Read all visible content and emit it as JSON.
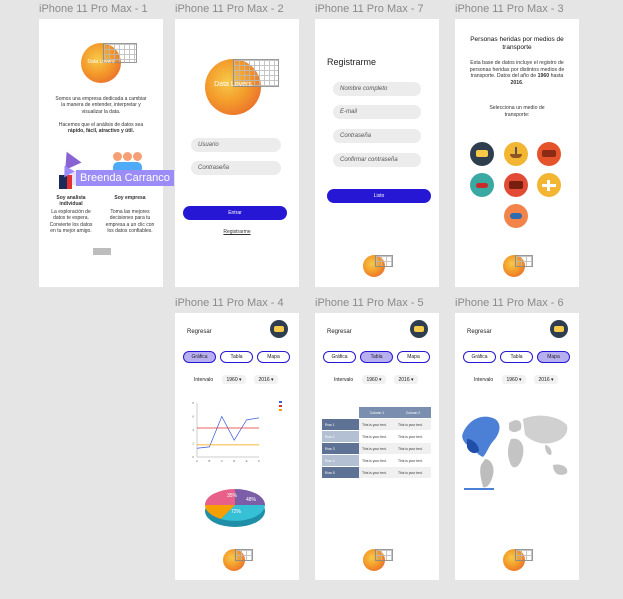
{
  "colors": {
    "canvas": "#e5e5e5",
    "accent": "#2617d4",
    "accent_light": "#b7b0f0",
    "label": "#8a8a8a"
  },
  "frames": {
    "f1": {
      "title": "iPhone 11 Pro Max - 1",
      "logo_text": "Data Lovers",
      "intro": "Somos una empresa dedicada a cambiar la manera de entender, interpretar y visualizar la data.",
      "intro2": "Hacemos que el análisis de datos sea",
      "intro2_bold": "rápido, fácil, atractivo y útil.",
      "left_title": "Soy analista individual",
      "left_desc": "La exploración de datos te espera. Convierte los datos en tu mejor amigo.",
      "right_title": "Soy empresa",
      "right_desc": "Toma las mejores decisiones para tu empresa a un clic con los datos confiables."
    },
    "f2": {
      "title": "iPhone 11 Pro Max - 2",
      "logo_text": "Data Lovers",
      "user_placeholder": "Usuario",
      "pass_placeholder": "Contraseña",
      "submit": "Entrar",
      "register_link": "Registrarme"
    },
    "f7": {
      "title": "iPhone 11 Pro Max - 7",
      "heading": "Registrarme",
      "name": "Nombre completo",
      "email": "E-mail",
      "pass": "Contraseña",
      "confirm": "Confirmar contraseña",
      "submit": "Listo"
    },
    "f3": {
      "title": "iPhone 11 Pro Max - 3",
      "heading": "Personas heridas por medios de transporte",
      "desc1": "Esta base de datos incluye el registro de personas heridas por distintos medios de transporte. Datos del año de",
      "year_from": "1960",
      "desc_mid": "hasta",
      "year_to": "2016",
      "desc_end": ".",
      "prompt": "Selecciona un medio de transporte:",
      "icons": [
        "bus-icon",
        "boat-icon",
        "train-icon",
        "motorcycle-icon",
        "truck-icon",
        "plane-icon",
        "car-icon"
      ]
    },
    "f4": {
      "title": "iPhone 11 Pro Max - 4",
      "back": "Regresar",
      "tabs": [
        "Gráfica",
        "Tabla",
        "Mapa"
      ],
      "interval": "Intervalo",
      "from": "1960",
      "to": "2016",
      "pie_labels": [
        "35%",
        "48%",
        "72%"
      ]
    },
    "f5": {
      "title": "iPhone 11 Pro Max - 5",
      "back": "Regresar",
      "tabs": [
        "Gráfica",
        "Tabla",
        "Mapa"
      ],
      "interval": "Intervalo",
      "from": "1960",
      "to": "2016",
      "col_headers": [
        "Column 1",
        "Column 2"
      ],
      "rows": [
        {
          "h": "Row 1",
          "a": "This is your text.",
          "b": "This is your text."
        },
        {
          "h": "Row 2",
          "a": "This is your text.",
          "b": "This is your text."
        },
        {
          "h": "Row 3",
          "a": "This is your text.",
          "b": "This is your text."
        },
        {
          "h": "Row 4",
          "a": "This is your text.",
          "b": "This is your text."
        },
        {
          "h": "Row 5",
          "a": "This is your text.",
          "b": "This is your text."
        }
      ]
    },
    "f6": {
      "title": "iPhone 11 Pro Max - 6",
      "back": "Regresar",
      "tabs": [
        "Gráfica",
        "Tabla",
        "Mapa"
      ],
      "interval": "Intervalo",
      "from": "1960",
      "to": "2016"
    }
  },
  "cursor_label": "Breenda Carranco",
  "chart_data": {
    "type": "line",
    "categories": [
      "A",
      "B",
      "C",
      "D",
      "E",
      "F"
    ],
    "series": [
      {
        "name": "",
        "color": "#3b5bdb",
        "values": [
          1.3,
          1.5,
          6.0,
          2.5,
          5.5,
          5.8
        ]
      },
      {
        "name": "",
        "color": "#e03131",
        "values": [
          4.3,
          4.3,
          4.3,
          4.3,
          4.3,
          4.3
        ]
      },
      {
        "name": "",
        "color": "#f59f00",
        "values": [
          1.8,
          1.8,
          1.8,
          1.8,
          1.8,
          1.8
        ]
      }
    ],
    "ylim": [
      0,
      8
    ]
  }
}
